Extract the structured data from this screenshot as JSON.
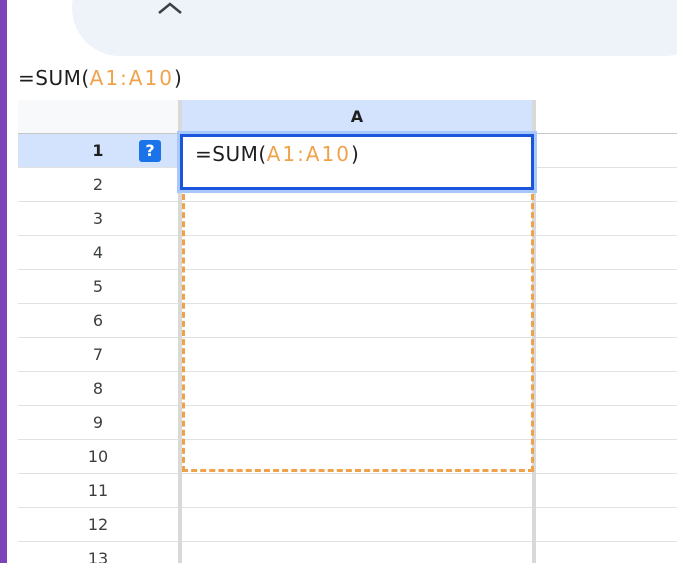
{
  "formula_bar": {
    "prefix": "=SUM(",
    "range": "A1:A10",
    "suffix": ")"
  },
  "sheet": {
    "column_header": "A",
    "row_numbers": [
      "1",
      "2",
      "3",
      "4",
      "5",
      "6",
      "7",
      "8",
      "9",
      "10",
      "11",
      "12",
      "13"
    ],
    "selected_row": "1",
    "help_badge": "?",
    "active_cell": {
      "prefix": "=SUM(",
      "range": "A1:A10",
      "suffix": ")"
    }
  },
  "colors": {
    "accent": "#7b45b9",
    "range_highlight": "#f0a24a",
    "active_cell_border": "#1a56db",
    "header_selected": "#d3e3fd"
  },
  "icons": {
    "top": "chevron-up-icon"
  }
}
